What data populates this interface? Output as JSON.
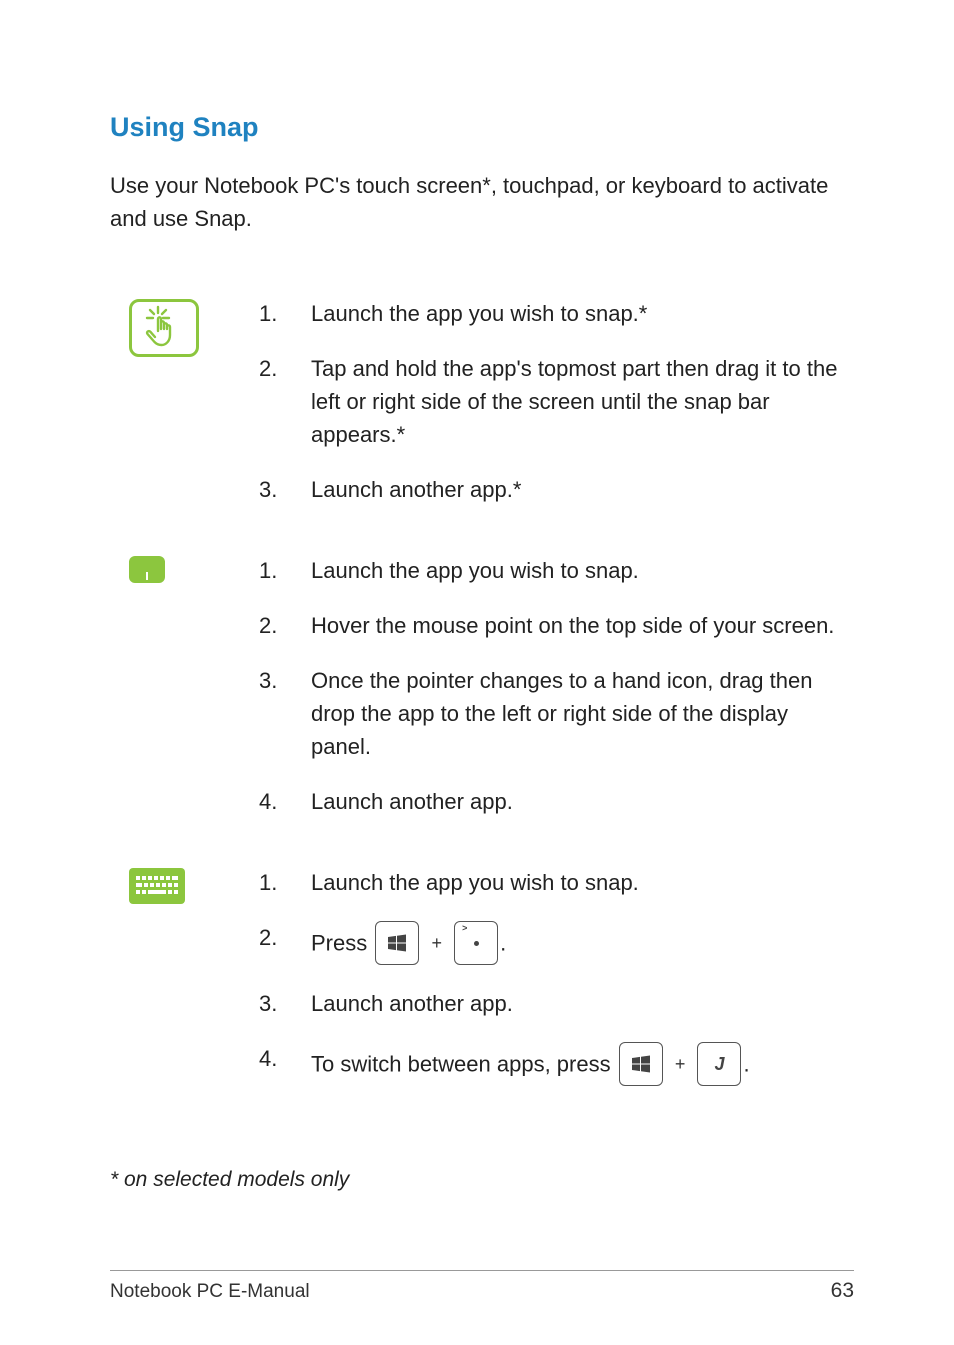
{
  "heading": "Using Snap",
  "intro": "Use your Notebook PC's touch screen*, touchpad, or keyboard to activate and use Snap.",
  "sections": {
    "touch": {
      "icon": "touch-icon",
      "steps": [
        {
          "num": "1.",
          "text": "Launch the app you wish to snap.*"
        },
        {
          "num": "2.",
          "text": "Tap and hold the app's topmost part then drag it to the left or right side of the screen until the snap bar appears.*"
        },
        {
          "num": "3.",
          "text": "Launch another app.*"
        }
      ]
    },
    "touchpad": {
      "icon": "touchpad-icon",
      "steps": [
        {
          "num": "1.",
          "text": "Launch the app you wish to snap."
        },
        {
          "num": "2.",
          "text": "Hover the mouse point on the top side of your screen."
        },
        {
          "num": "3.",
          "text": "Once the pointer changes to a hand icon, drag then drop the app to the left or right side of the display panel."
        },
        {
          "num": "4.",
          "text": "Launch another app."
        }
      ]
    },
    "keyboard": {
      "icon": "keyboard-icon",
      "steps": [
        {
          "num": "1.",
          "text": "Launch the app you wish to snap."
        },
        {
          "num": "2.",
          "segments": {
            "before": "Press ",
            "key1": "windows-key",
            "plus": "+",
            "key2": "period-key",
            "after": "."
          }
        },
        {
          "num": "3.",
          "text": "Launch another app."
        },
        {
          "num": "4.",
          "segments": {
            "before": "To switch between apps, press ",
            "key1": "windows-key",
            "plus": "+",
            "key2_letter": "J",
            "after": "."
          }
        }
      ]
    }
  },
  "footnote": "* on selected models only",
  "footer": {
    "title": "Notebook PC E-Manual",
    "page": "63"
  }
}
